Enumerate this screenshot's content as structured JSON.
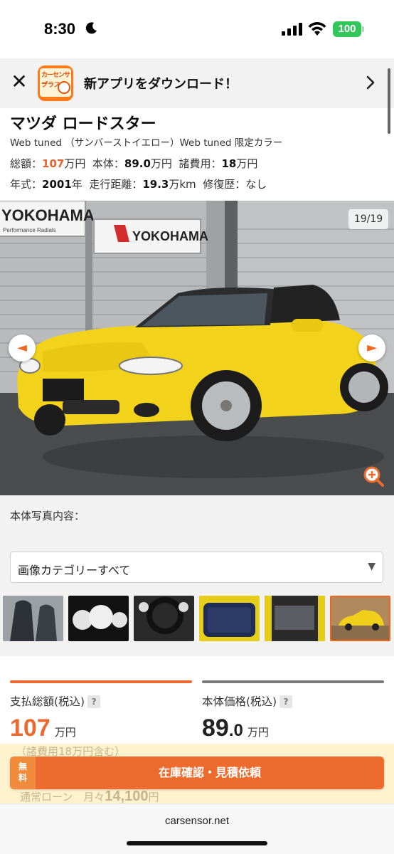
{
  "status_bar": {
    "time": "8:30",
    "battery": "100"
  },
  "app_banner": {
    "icon_line1": "カーセンサー",
    "icon_line2": "プラス",
    "text": "新アプリをダウンロード！"
  },
  "car": {
    "title": "マツダ ロードスター",
    "grade": "Web tuned （サンバーストイエロー）Web tuned 限定カラー",
    "total_label": "総額：",
    "total_value": "107",
    "body_label": "本体：",
    "body_value": "89.0",
    "fees_label": "諸費用：",
    "fees_value": "18",
    "man_yen": "万円",
    "year_label": "年式：",
    "year_value": "2001",
    "year_unit": "年",
    "mileage_label": "走行距離：",
    "mileage_value": "19.3",
    "mileage_unit": "万km",
    "repair_label": "修復歴：",
    "repair_value": "なし"
  },
  "photo": {
    "counter": "19/19",
    "prev_arrow": "◄",
    "next_arrow": "►",
    "sign_text": "YOKOHAMA",
    "sign_sub": "Performance Radials"
  },
  "photo_section": {
    "content_label": "本体写真内容：",
    "category_selected": "画像カテゴリーすべて",
    "caret": "▼",
    "thumbnails": [
      "seats",
      "gauges",
      "steering",
      "trunk",
      "engine",
      "exterior"
    ]
  },
  "prices": {
    "total": {
      "label": "支払総額(税込)",
      "help": "?",
      "value": "107",
      "unit": "万円"
    },
    "body": {
      "label": "本体価格(税込)",
      "help": "?",
      "value_int": "89",
      "value_dec": ".0",
      "unit": "万円"
    },
    "fee_note": "（諸費用18万円含む）",
    "loan_label": "通常ローン　月々",
    "loan_value": "14,100",
    "loan_unit": "円"
  },
  "cta": {
    "free_line1": "無",
    "free_line2": "料",
    "label": "在庫確認・見積依頼"
  },
  "browser": {
    "url": "carsensor.net"
  },
  "colors": {
    "accent": "#ec6b2d",
    "body_yellow": "#f2d21a",
    "battery_green": "#33c759"
  }
}
